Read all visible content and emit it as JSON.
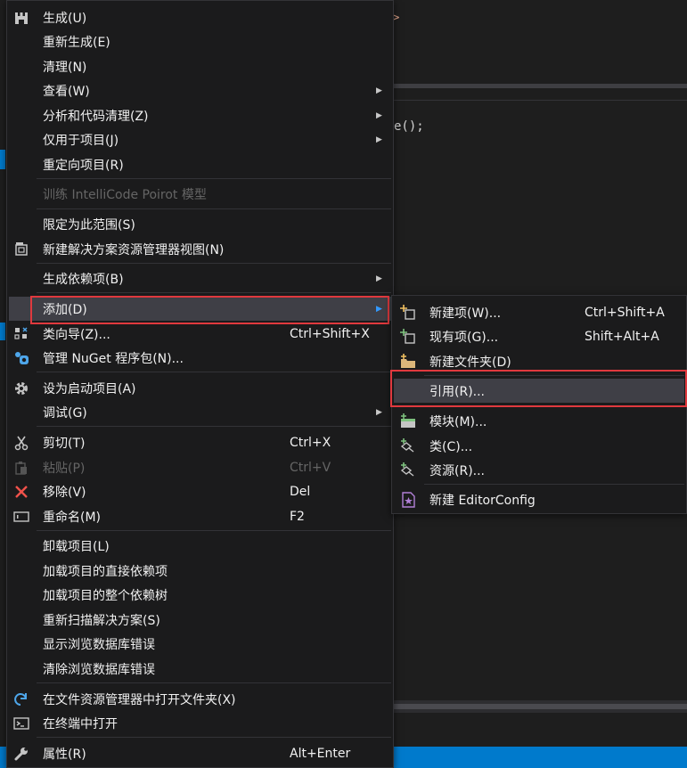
{
  "background": {
    "code_top": "",
    "code_call": "e();",
    "code_call_name": "e",
    "code_call_rest": "();"
  },
  "main_menu": {
    "items": [
      {
        "label": "生成(U)",
        "icon": "build-icon"
      },
      {
        "label": "重新生成(E)"
      },
      {
        "label": "清理(N)"
      },
      {
        "label": "查看(W)",
        "submenu": true
      },
      {
        "label": "分析和代码清理(Z)",
        "submenu": true
      },
      {
        "label": "仅用于项目(J)",
        "submenu": true
      },
      {
        "label": "重定向项目(R)"
      },
      {
        "label": "训练 IntelliCode Poirot 模型",
        "disabled": true
      },
      {
        "label": "限定为此范围(S)"
      },
      {
        "label": "新建解决方案资源管理器视图(N)",
        "icon": "new-view-icon"
      },
      {
        "label": "生成依赖项(B)",
        "submenu": true
      },
      {
        "label": "添加(D)",
        "submenu": true,
        "highlighted": true
      },
      {
        "label": "类向导(Z)...",
        "shortcut": "Ctrl+Shift+X",
        "icon": "class-wizard-icon"
      },
      {
        "label": "管理 NuGet 程序包(N)...",
        "icon": "nuget-icon"
      },
      {
        "label": "设为启动项目(A)",
        "icon": "gear-icon"
      },
      {
        "label": "调试(G)",
        "submenu": true
      },
      {
        "label": "剪切(T)",
        "shortcut": "Ctrl+X",
        "icon": "cut-icon"
      },
      {
        "label": "粘贴(P)",
        "shortcut": "Ctrl+V",
        "icon": "paste-icon",
        "disabled": true
      },
      {
        "label": "移除(V)",
        "shortcut": "Del",
        "icon": "remove-icon"
      },
      {
        "label": "重命名(M)",
        "shortcut": "F2",
        "icon": "rename-icon"
      },
      {
        "label": "卸载项目(L)"
      },
      {
        "label": "加载项目的直接依赖项"
      },
      {
        "label": "加载项目的整个依赖树"
      },
      {
        "label": "重新扫描解决方案(S)"
      },
      {
        "label": "显示浏览数据库错误"
      },
      {
        "label": "清除浏览数据库错误"
      },
      {
        "label": "在文件资源管理器中打开文件夹(X)",
        "icon": "open-folder-icon"
      },
      {
        "label": "在终端中打开",
        "icon": "terminal-icon"
      },
      {
        "label": "属性(R)",
        "shortcut": "Alt+Enter",
        "icon": "wrench-icon"
      }
    ]
  },
  "sub_menu": {
    "items": [
      {
        "label": "新建项(W)...",
        "shortcut": "Ctrl+Shift+A",
        "icon": "new-item-icon"
      },
      {
        "label": "现有项(G)...",
        "shortcut": "Shift+Alt+A",
        "icon": "existing-item-icon"
      },
      {
        "label": "新建文件夹(D)",
        "icon": "new-folder-icon"
      },
      {
        "label": "引用(R)...",
        "highlighted": true
      },
      {
        "label": "模块(M)...",
        "icon": "module-icon"
      },
      {
        "label": "类(C)...",
        "icon": "class-icon"
      },
      {
        "label": "资源(R)...",
        "icon": "resource-icon"
      },
      {
        "label": "新建 EditorConfig",
        "icon": "editorconfig-icon"
      }
    ]
  },
  "colors": {
    "menu_bg": "#1b1b1c",
    "highlight_bg": "#3f3f46",
    "callout_red": "#e0393e",
    "status_blue": "#007acc"
  }
}
